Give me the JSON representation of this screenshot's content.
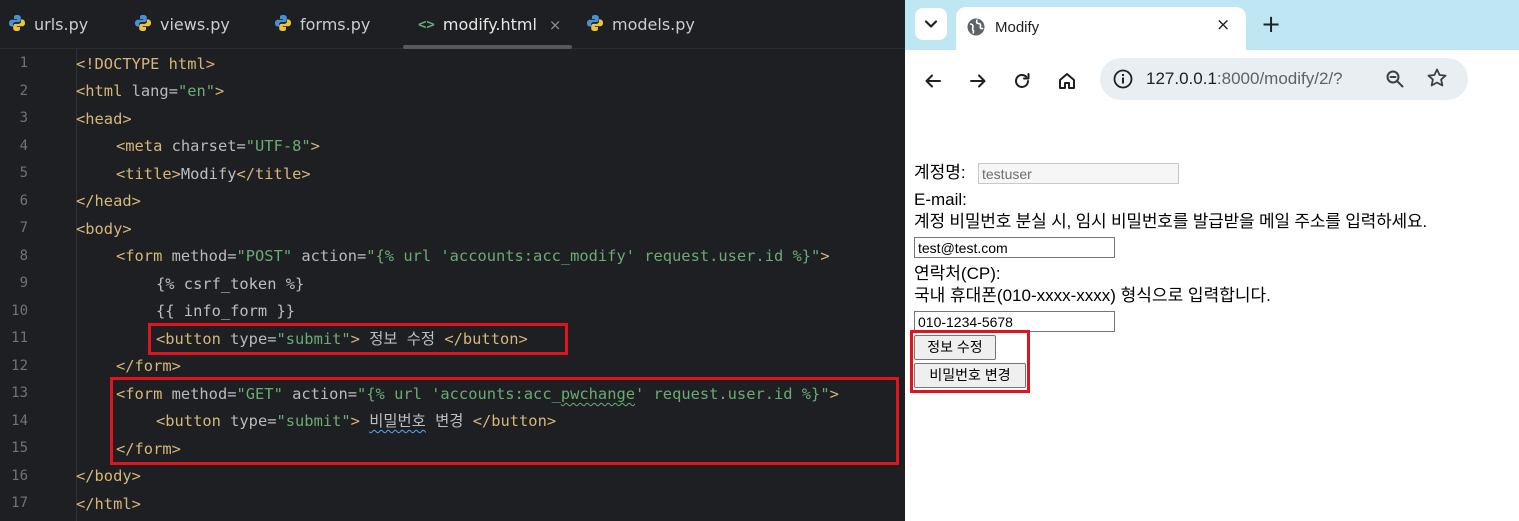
{
  "editor": {
    "tabs": [
      {
        "label": "urls.py",
        "icon": "python-icon"
      },
      {
        "label": "views.py",
        "icon": "python-icon"
      },
      {
        "label": "forms.py",
        "icon": "python-icon"
      },
      {
        "label": "modify.html",
        "icon": "html-icon",
        "active": true
      },
      {
        "label": "models.py",
        "icon": "python-icon"
      }
    ],
    "html_icon_glyph": "<>",
    "close_glyph": "×",
    "line_numbers": [
      "1",
      "2",
      "3",
      "4",
      "5",
      "6",
      "7",
      "8",
      "9",
      "10",
      "11",
      "12",
      "13",
      "14",
      "15",
      "16",
      "17"
    ],
    "code": {
      "l1": {
        "a": "<!DOCTYPE html>"
      },
      "l2": {
        "a": "<html",
        "b": " lang",
        "c": "=",
        "d": "\"en\"",
        "e": ">"
      },
      "l3": {
        "a": "<head>"
      },
      "l4": {
        "a": "<meta",
        "b": " charset",
        "c": "=",
        "d": "\"UTF-8\"",
        "e": ">"
      },
      "l5": {
        "a": "<title>",
        "b": "Modify",
        "c": "</title>"
      },
      "l6": {
        "a": "</head>"
      },
      "l7": {
        "a": "<body>"
      },
      "l8": {
        "a": "<form",
        "b": " method",
        "c": "=",
        "d": "\"POST\"",
        "e": " action",
        "f": "=",
        "g": "\"{% url 'accounts:acc_modify' request.user.id %}\"",
        "h": ">"
      },
      "l9": {
        "a": "{% csrf_token %}"
      },
      "l10": {
        "a": "{{ info_form }}"
      },
      "l11": {
        "a": "<button",
        "b": " type",
        "c": "=",
        "d": "\"submit\"",
        "e": ">",
        "f": " 정보 수정 ",
        "g": "</button>"
      },
      "l12": {
        "a": "</form>"
      },
      "l13": {
        "a": "<form",
        "b": " method",
        "c": "=",
        "d": "\"GET\"",
        "e": " action",
        "f": "=",
        "g1": "\"{% url 'accounts:acc_",
        "g2": "pwchange",
        "g3": "' request.user.id %}\"",
        "h": ">"
      },
      "l14": {
        "a": "<button",
        "b": " type",
        "c": "=",
        "d": "\"submit\"",
        "e": ">",
        "f1": " ",
        "f2": "비밀번호",
        "f3": " 변경 ",
        "g": "</button>"
      },
      "l15": {
        "a": "</form>"
      },
      "l16": {
        "a": "</body>"
      },
      "l17": {
        "a": "</html>"
      }
    }
  },
  "browser": {
    "tab_title": "Modify",
    "tab_close": "×",
    "new_tab": "+",
    "url_host": "127.0.0.1",
    "url_path": ":8000/modify/2/?",
    "page": {
      "username_label": "계정명:",
      "username_value": "testuser",
      "email_label": "E-mail:",
      "email_help": "계정 비밀번호 분실 시, 임시 비밀번호를 발급받을 메일 주소를 입력하세요.",
      "email_value": "test@test.com",
      "phone_label": "연락처(CP):",
      "phone_help": "국내 휴대폰(010-xxxx-xxxx) 형식으로 입력합니다.",
      "phone_value": "010-1234-5678",
      "modify_button": "정보 수정",
      "pwchange_button": "비밀번호 변경"
    }
  },
  "colors": {
    "editor_bg": "#1e1f22",
    "tag": "#d5b778",
    "string": "#6aab73",
    "highlight_box": "#e0141f",
    "browser_tabstrip": "#bfe7f3"
  }
}
